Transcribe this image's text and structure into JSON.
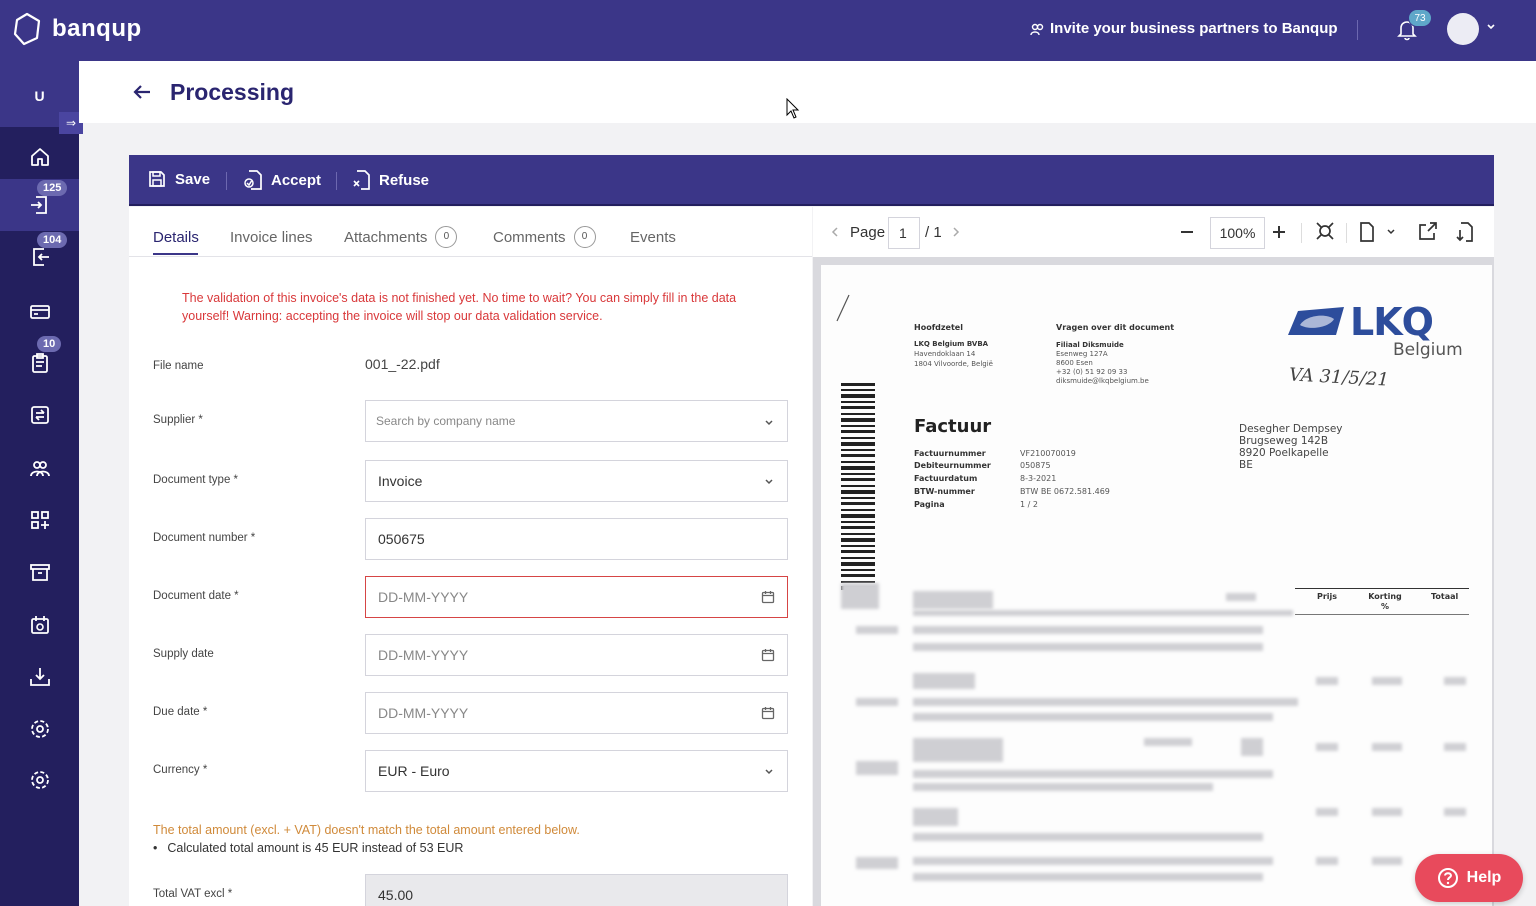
{
  "app": {
    "brand": "banqup",
    "invite": "Invite your business partners to Banqup",
    "notifications": "73"
  },
  "sidebar": {
    "user_initial": "U",
    "expand": "⇒",
    "badges": {
      "inbox": "125",
      "outbox": "104",
      "tasks": "10"
    }
  },
  "page": {
    "title": "Processing"
  },
  "toolbar": {
    "save": "Save",
    "accept": "Accept",
    "refuse": "Refuse"
  },
  "tabs": {
    "details": "Details",
    "invoice_lines": "Invoice lines",
    "attachments": "Attachments",
    "attachments_count": "0",
    "comments": "Comments",
    "comments_count": "0",
    "events": "Events"
  },
  "form": {
    "warning": "The validation of this invoice's data is not finished yet. No time to wait? You can simply fill in the data yourself! Warning: accepting the invoice will stop our data validation service.",
    "file_name_label": "File name",
    "file_name": "001_-22.pdf",
    "supplier_label": "Supplier *",
    "supplier_placeholder": "Search by company name",
    "doc_type_label": "Document type *",
    "doc_type": "Invoice",
    "doc_number_label": "Document number *",
    "doc_number": "050675",
    "doc_date_label": "Document date *",
    "date_placeholder": "DD-MM-YYYY",
    "supply_date_label": "Supply date",
    "due_date_label": "Due date *",
    "currency_label": "Currency *",
    "currency": "EUR - Euro",
    "amount_warning": "The total amount (excl. + VAT) doesn't match the total amount entered below.",
    "amount_detail": "Calculated total amount is 45 EUR instead of 53 EUR",
    "total_excl_label": "Total VAT excl *",
    "total_excl": "45.00"
  },
  "viewer": {
    "page_label": "Page",
    "page": "1",
    "page_total": "/ 1",
    "zoom": "100%"
  },
  "document": {
    "hq_title": "Hoofdzetel",
    "hq_lines": [
      "LKQ Belgium BVBA",
      "Havendoklaan 14",
      "1804 Vilvoorde, België"
    ],
    "q_title": "Vragen over dit document",
    "q_lines": [
      "Filiaal Diksmuide",
      "Esenweg 127A",
      "8600 Esen",
      "+32 (0) 51 92 09 33",
      "diksmuide@lkqbelgium.be"
    ],
    "logo": "LKQ",
    "logo_sub": "Belgium",
    "handwriting": "VA  31/5/21",
    "title": "Factuur",
    "meta_labels": [
      "Factuurnummer",
      "Debiteurnummer",
      "Factuurdatum",
      "BTW-nummer",
      "Pagina"
    ],
    "meta_values": [
      "VF210070019",
      "050875",
      "8-3-2021",
      "BTW BE 0672.581.469",
      "1 / 2"
    ],
    "recipient": [
      "Desegher Dempsey",
      "Brugseweg 142B",
      "8920 Poelkapelle",
      "BE"
    ],
    "cols": [
      "Prijs",
      "Korting %",
      "Totaal"
    ]
  },
  "help": "Help"
}
